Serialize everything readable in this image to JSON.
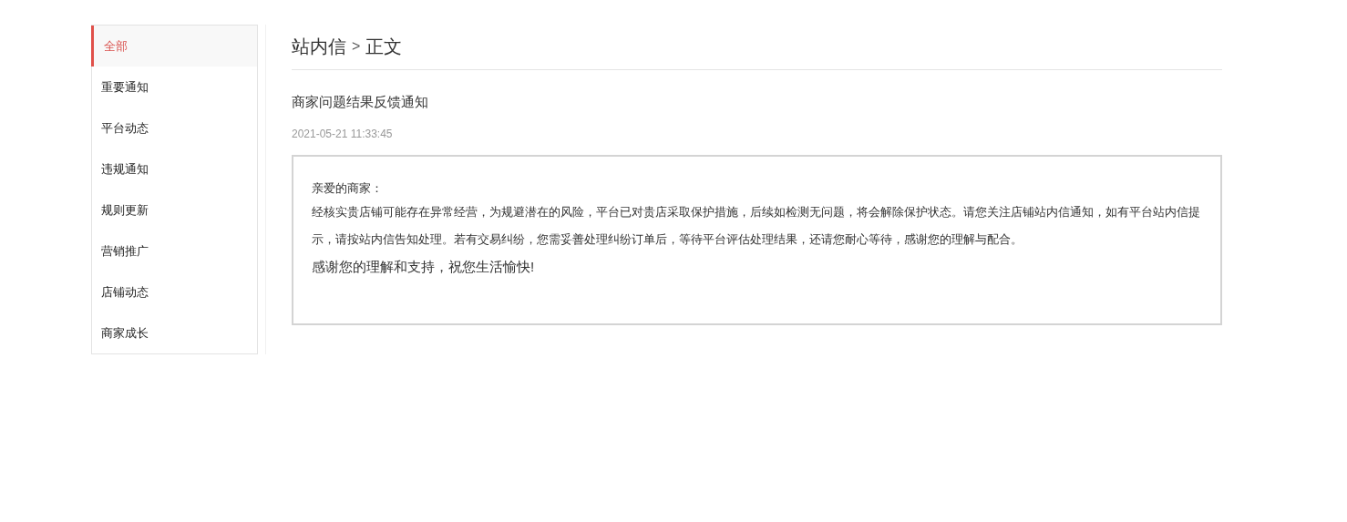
{
  "sidebar": {
    "items": [
      {
        "label": "全部",
        "selected": true
      },
      {
        "label": "重要通知",
        "selected": false
      },
      {
        "label": "平台动态",
        "selected": false
      },
      {
        "label": "违规通知",
        "selected": false
      },
      {
        "label": "规则更新",
        "selected": false
      },
      {
        "label": "营销推广",
        "selected": false
      },
      {
        "label": "店铺动态",
        "selected": false
      },
      {
        "label": "商家成长",
        "selected": false
      }
    ]
  },
  "breadcrumb": [
    "站内信",
    ">",
    "正文"
  ],
  "message": {
    "title": "商家问题结果反馈通知",
    "date": "2021-05-21 11:33:45",
    "greeting": "亲爱的商家：",
    "body": "经核实贵店铺可能存在异常经营，为规避潜在的风险，平台已对贵店采取保护措施，后续如检测无问题，将会解除保护状态。请您关注店铺站内信通知，如有平台站内信提示，请按站内信告知处理。若有交易纠纷，您需妥善处理纠纷订单后，等待平台评估处理结果，还请您耐心等待，感谢您的理解与配合。",
    "closing": "感谢您的理解和支持，祝您生活愉快!"
  }
}
